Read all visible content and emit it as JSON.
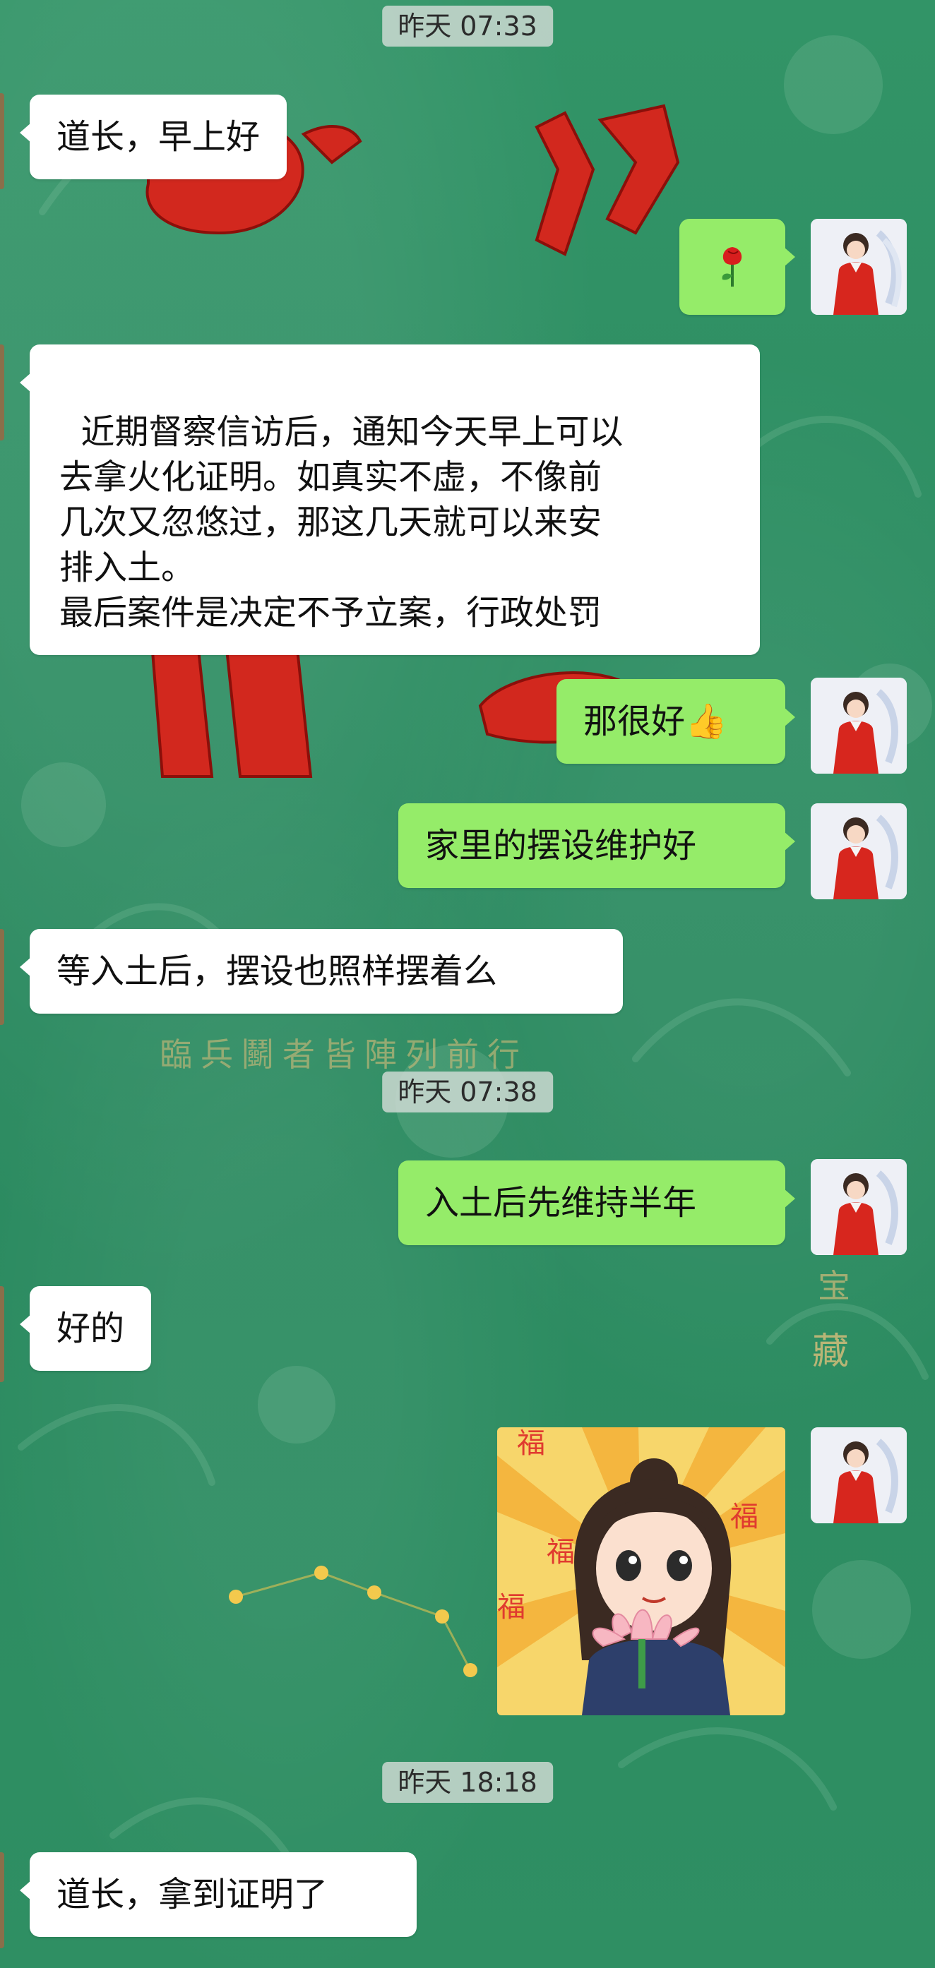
{
  "chat": {
    "timestamps": [
      "昨天 07:33",
      "昨天 07:38",
      "昨天 18:18"
    ],
    "messages": [
      {
        "side": "in",
        "text": "道长，早上好"
      },
      {
        "side": "out",
        "text": "🌹",
        "kind": "emoji"
      },
      {
        "side": "in",
        "text": "近期督察信访后，通知今天早上可以\n去拿火化证明。如真实不虚，不像前\n几次又忽悠过，那这几天就可以来安\n排入土。\n最后案件是决定不予立案，行政处罚"
      },
      {
        "side": "out",
        "text": "那很好👍"
      },
      {
        "side": "out",
        "text": "家里的摆设维护好"
      },
      {
        "side": "in",
        "text": "等入土后，摆设也照样摆着么"
      },
      {
        "side": "out",
        "text": "入土后先维持半年"
      },
      {
        "side": "in",
        "text": "好的"
      },
      {
        "side": "out",
        "kind": "sticker",
        "text": "福",
        "sticker_name": "lotus-girl-fu-sticker"
      },
      {
        "side": "in",
        "text": "道长，拿到证明了"
      }
    ]
  },
  "background": {
    "caption": "臨兵鬬者皆陣列前行",
    "side_text": "藏",
    "side_text_top": "宝"
  },
  "colors": {
    "background": "#2f8f63",
    "incoming_bubble": "#ffffff",
    "outgoing_bubble": "#95ec69",
    "timestamp_pill": "#d2dcd6",
    "accent_red": "#d2281e"
  }
}
